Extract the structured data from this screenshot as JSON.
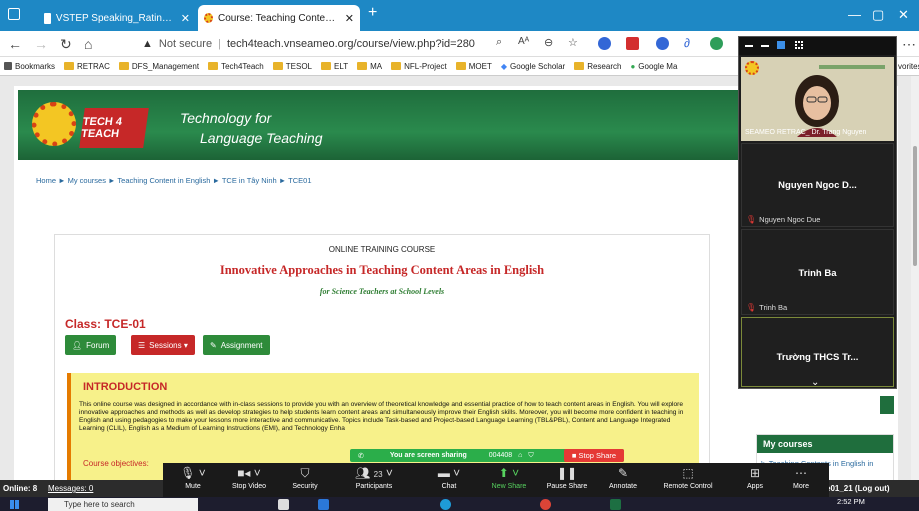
{
  "browser": {
    "tabs": [
      {
        "title": "VSTEP Speaking_Rating Scale.pdf",
        "active": false
      },
      {
        "title": "Course: Teaching Contents in En",
        "active": true
      }
    ],
    "new_tab": "+",
    "url_prefix": "Not secure",
    "url": "tech4teach.vnseameo.org/course/view.php?id=280"
  },
  "bookmarks": [
    "Bookmarks",
    "RETRAC",
    "DFS_Management",
    "Tech4Teach",
    "TESOL",
    "ELT",
    "MA",
    "NFL-Project",
    "MOET",
    "Google Scholar",
    "Research",
    "Google Ma",
    "vorites"
  ],
  "site": {
    "logo_text": "TECH 4 TEACH",
    "brand_line1": "Technology for",
    "brand_line2": "Language Teaching",
    "breadcrumb": "Home ► My courses ► Teaching Content in English ► TCE in Tây Ninh ► TCE01"
  },
  "course": {
    "kind": "ONLINE TRAINING COURSE",
    "title": "Innovative Approaches in Teaching Content Areas in English",
    "subtitle": "for Science Teachers at School Levels",
    "class_label": "Class: TCE-01",
    "buttons": {
      "forum": "Forum",
      "sessions": "Sessions ▾",
      "assignment": "Assignment"
    },
    "intro_title": "INTRODUCTION",
    "intro_text": "This online course was designed in accordance with in-class sessions to provide you with an overview of theoretical knowledge and essential practice of how to teach content areas in English. You will explore innovative approaches and methods as well as develop strategies to help students learn content areas and simultaneously improve their English skills. Moreover, you will become more confident in teaching in English and using pedagogies to make your lessons more interactive and communicative. Topics include Task-based and Project-based Language Learning (TBL&PBL), Content and Language Integrated Learning (CLIL), English as a Medium of Learning Instructions (EMI), and Technology Enha",
    "intro_objectives": "Course objectives:"
  },
  "sidebar": {
    "my_courses_title": "My courses",
    "my_courses_item": "Teaching Contents in English in"
  },
  "zoom": {
    "speaker_label": "SEAMEO RETRAC_ Dr. Trang Nguyen",
    "participants": [
      {
        "display": "Nguyen Ngoc D...",
        "label": "Nguyen Ngoc Due"
      },
      {
        "display": "Trinh Ba",
        "label": "Trinh Ba"
      },
      {
        "display": "Trường THCS Tr...",
        "label": ""
      }
    ],
    "share_banner": "You are screen sharing",
    "share_id": "004408",
    "stop_share": "Stop Share",
    "participants_count": "23",
    "toolbar": [
      {
        "label": "Mute",
        "icon": "microphone-icon"
      },
      {
        "label": "Stop Video",
        "icon": "video-icon"
      },
      {
        "label": "Security",
        "icon": "shield-icon"
      },
      {
        "label": "Participants",
        "icon": "participants-icon"
      },
      {
        "label": "Chat",
        "icon": "chat-icon"
      },
      {
        "label": "New Share",
        "icon": "share-icon"
      },
      {
        "label": "Pause Share",
        "icon": "pause-icon"
      },
      {
        "label": "Annotate",
        "icon": "pen-icon"
      },
      {
        "label": "Remote Control",
        "icon": "mouse-icon"
      },
      {
        "label": "Apps",
        "icon": "apps-icon"
      },
      {
        "label": "More",
        "icon": "more-icon"
      }
    ]
  },
  "footer": {
    "online": "Online: 8",
    "messages": "Messages: 0",
    "logout": "e01_21 (Log out)"
  },
  "taskbar": {
    "search_placeholder": "Type here to search",
    "time": "2:52 PM"
  }
}
